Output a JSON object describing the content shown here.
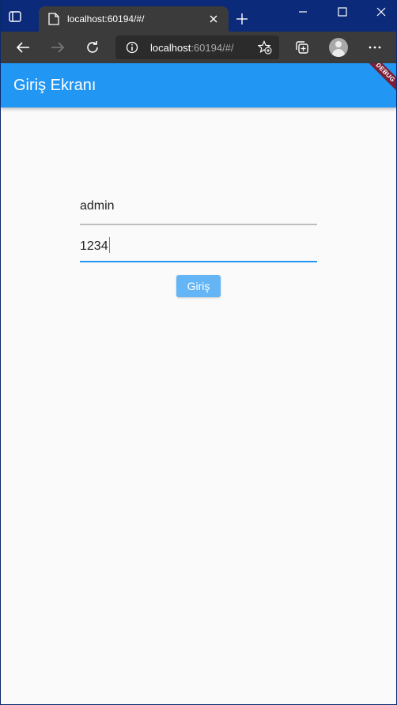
{
  "browser": {
    "tab_title": "localhost:60194/#/",
    "address_host": "localhost",
    "address_rest": ":60194/#/",
    "accent_color": "#2196f3"
  },
  "app": {
    "title": "Giriş Ekranı",
    "debug_banner": "DEBUG",
    "username_value": "admin",
    "password_value": "1234",
    "login_button": "Giriş"
  }
}
